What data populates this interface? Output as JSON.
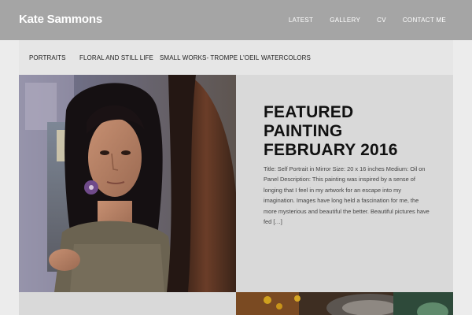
{
  "header": {
    "site_title": "Kate Sammons",
    "nav": [
      "LATEST",
      "GALLERY",
      "CV",
      "CONTACT ME"
    ]
  },
  "categories": [
    "PORTRAITS",
    "FLORAL AND STILL LIFE",
    "SMALL WORKS- TROMPE L'OEIL",
    "WATERCOLORS"
  ],
  "featured": {
    "title_line1": "FEATURED",
    "title_line2": "PAINTING",
    "title_line3": "FEBRUARY 2016",
    "excerpt": "Title: Self Portrait in Mirror Size: 20 x 16 inches Medium: Oil on Panel Description: This painting was inspired by a sense of longing that I feel in my artwork for an escape into my imagination. Images have long held a fascination for me, the more mysterious and beautiful the better. Beautiful pictures have fed",
    "read_more": "[…]"
  },
  "colors": {
    "header_bg": "#a5a5a5",
    "subnav_bg": "#e6e6e6",
    "panel_bg": "#d9d9d9"
  }
}
